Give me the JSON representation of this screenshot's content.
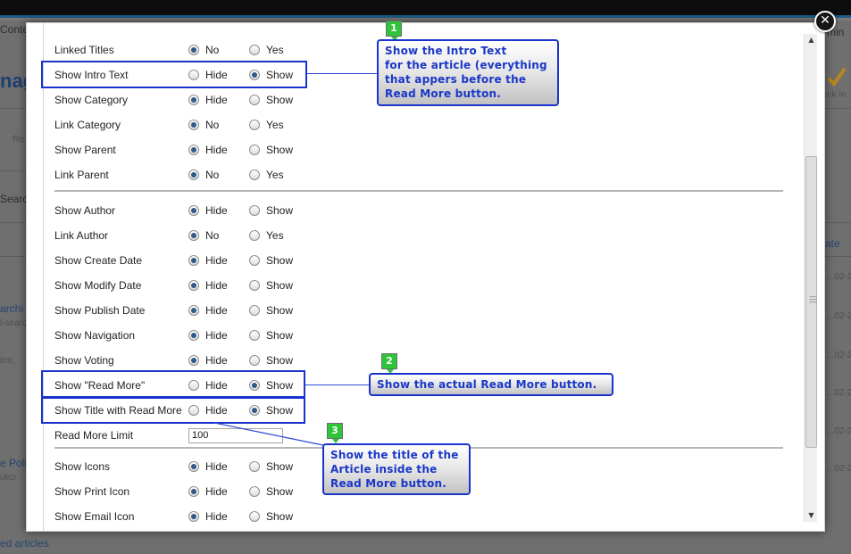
{
  "background": {
    "fragments": [
      "Conte",
      "min",
      "nag",
      "eck In",
      "Re",
      "Searc",
      "ate",
      "archi",
      "l-searc",
      "...02-2",
      "tml,",
      "e Polic",
      "ulicr",
      "ed articles"
    ]
  },
  "modal": {
    "close_icon": "close-icon",
    "groups": [
      {
        "rows": [
          {
            "label": "Linked Titles",
            "options": [
              "No",
              "Yes"
            ],
            "selected": 0
          },
          {
            "label": "Show Intro Text",
            "options": [
              "Hide",
              "Show"
            ],
            "selected": 1
          },
          {
            "label": "Show Category",
            "options": [
              "Hide",
              "Show"
            ],
            "selected": 0
          },
          {
            "label": "Link Category",
            "options": [
              "No",
              "Yes"
            ],
            "selected": 0
          },
          {
            "label": "Show Parent",
            "options": [
              "Hide",
              "Show"
            ],
            "selected": 0
          },
          {
            "label": "Link Parent",
            "options": [
              "No",
              "Yes"
            ],
            "selected": 0
          }
        ]
      },
      {
        "rows": [
          {
            "label": "Show Author",
            "options": [
              "Hide",
              "Show"
            ],
            "selected": 0
          },
          {
            "label": "Link Author",
            "options": [
              "No",
              "Yes"
            ],
            "selected": 0
          },
          {
            "label": "Show Create Date",
            "options": [
              "Hide",
              "Show"
            ],
            "selected": 0
          },
          {
            "label": "Show Modify Date",
            "options": [
              "Hide",
              "Show"
            ],
            "selected": 0
          },
          {
            "label": "Show Publish Date",
            "options": [
              "Hide",
              "Show"
            ],
            "selected": 0
          },
          {
            "label": "Show Navigation",
            "options": [
              "Hide",
              "Show"
            ],
            "selected": 0
          },
          {
            "label": "Show Voting",
            "options": [
              "Hide",
              "Show"
            ],
            "selected": 0
          },
          {
            "label": "Show \"Read More\"",
            "options": [
              "Hide",
              "Show"
            ],
            "selected": 1
          },
          {
            "label": "Show Title with Read More",
            "options": [
              "Hide",
              "Show"
            ],
            "selected": 1
          },
          {
            "label": "Read More Limit",
            "value": "100"
          }
        ]
      },
      {
        "rows": [
          {
            "label": "Show Icons",
            "options": [
              "Hide",
              "Show"
            ],
            "selected": 0
          },
          {
            "label": "Show Print Icon",
            "options": [
              "Hide",
              "Show"
            ],
            "selected": 0
          },
          {
            "label": "Show Email Icon",
            "options": [
              "Hide",
              "Show"
            ],
            "selected": 0
          }
        ]
      }
    ]
  },
  "annotations": [
    {
      "number": "1",
      "text": [
        "Show the Intro Text",
        "for the article (everything",
        "that appers before the",
        "Read More button."
      ]
    },
    {
      "number": "2",
      "text": [
        "Show the actual Read More button."
      ]
    },
    {
      "number": "3",
      "text": [
        "Show the title of the",
        "Article inside the",
        "Read More button."
      ]
    }
  ],
  "colors": {
    "annotation": "#1a33cc",
    "badge": "#2fc53a",
    "radio_selected": "#2d5a88",
    "header_bar": "#1d5b86"
  }
}
